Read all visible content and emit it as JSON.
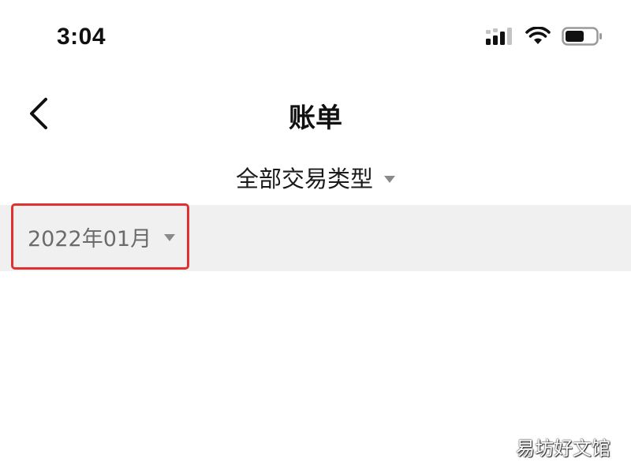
{
  "status_bar": {
    "time": "3:04",
    "icons": [
      "signal-icon",
      "wifi-icon",
      "battery-icon"
    ]
  },
  "nav": {
    "title": "账单",
    "back_icon": "chevron-left-icon"
  },
  "filters": {
    "transaction_type": "全部交易类型",
    "month": "2022年01月"
  },
  "highlight_color": "#e03030",
  "watermark": "易坊好文馆"
}
